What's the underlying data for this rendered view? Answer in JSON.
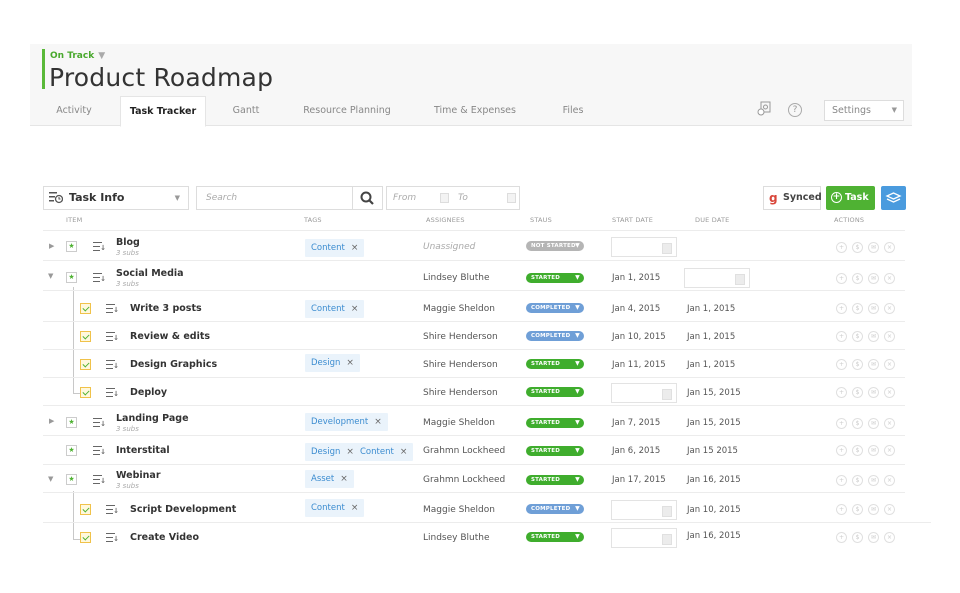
{
  "header": {
    "status": "On Track",
    "title": "Product Roadmap",
    "tabs": [
      {
        "label": "Activity"
      },
      {
        "label": "Task Tracker"
      },
      {
        "label": "Gantt"
      },
      {
        "label": "Resource Planning"
      },
      {
        "label": "Time  & Expenses"
      },
      {
        "label": "Files"
      }
    ],
    "active_tab": "Task Tracker",
    "help": "?",
    "settings_label": "Settings"
  },
  "toolbar": {
    "view_label": "Task Info",
    "search_placeholder": "Search",
    "from_label": "From",
    "to_label": "To",
    "synced_label": "Synced",
    "add_task_label": "Task"
  },
  "columns": {
    "item": "ITEM",
    "tags": "TAGS",
    "assignees": "ASSIGNEES",
    "status": "STAUS",
    "start_date": "START DATE",
    "due_date": "DUE DATE",
    "actions": "ACTIONS"
  },
  "rows": [
    {
      "name": "Blog",
      "subs": "3 subs",
      "tags": [
        "Content"
      ],
      "assignee": "Unassigned",
      "status": "NOT STARTED",
      "start": "",
      "due": ""
    },
    {
      "name": "Social Media",
      "subs": "3 subs",
      "tags": [],
      "assignee": "Lindsey Bluthe",
      "status": "STARTED",
      "start": "Jan 1, 2015",
      "due": ""
    },
    {
      "name": "Write 3 posts",
      "subs": "",
      "tags": [
        "Content"
      ],
      "assignee": "Maggie Sheldon",
      "status": "COMPLETED",
      "start": "Jan 4, 2015",
      "due": "Jan 1, 2015"
    },
    {
      "name": "Review & edits",
      "subs": "",
      "tags": [],
      "assignee": "Shire Henderson",
      "status": "COMPLETED",
      "start": "Jan 10, 2015",
      "due": "Jan 1, 2015"
    },
    {
      "name": "Design Graphics",
      "subs": "",
      "tags": [
        "Design"
      ],
      "assignee": "Shire Henderson",
      "status": "STARTED",
      "start": "Jan 11, 2015",
      "due": "Jan 1, 2015"
    },
    {
      "name": "Deploy",
      "subs": "",
      "tags": [],
      "assignee": "Shire Henderson",
      "status": "STARTED",
      "start": "",
      "due": "Jan 15, 2015"
    },
    {
      "name": "Landing Page",
      "subs": "3 subs",
      "tags": [
        "Development"
      ],
      "assignee": "Maggie Sheldon",
      "status": "STARTED",
      "start": "Jan 7, 2015",
      "due": "Jan 15, 2015"
    },
    {
      "name": "Interstital",
      "subs": "",
      "tags": [
        "Design",
        "Content"
      ],
      "assignee": "Grahmn Lockheed",
      "status": "STARTED",
      "start": "Jan 6, 2015",
      "due": "Jan 15 2015"
    },
    {
      "name": "Webinar",
      "subs": "3 subs",
      "tags": [
        "Asset"
      ],
      "assignee": "Grahmn Lockheed",
      "status": "STARTED",
      "start": "Jan 17, 2015",
      "due": "Jan 16, 2015"
    },
    {
      "name": "Script Development",
      "subs": "",
      "tags": [
        "Content"
      ],
      "assignee": "Maggie Sheldon",
      "status": "COMPLETED",
      "start": "",
      "due": "Jan 10, 2015"
    },
    {
      "name": "Create Video",
      "subs": "",
      "tags": [],
      "assignee": "Lindsey Bluthe",
      "status": "STARTED",
      "start": "",
      "due": "Jan 16, 2015"
    }
  ],
  "colors": {
    "accent_green": "#4fb233",
    "completed_blue": "#6f9fd7",
    "tag_blue": "#3b8cd0",
    "not_started_gray": "#b5b5b5"
  }
}
